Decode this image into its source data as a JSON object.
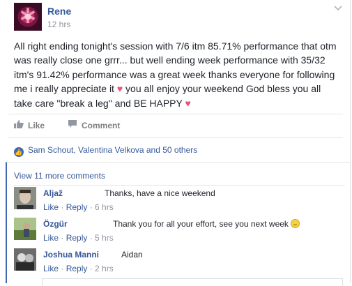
{
  "post": {
    "author": "Rene",
    "time": "12 hrs",
    "text": "All right ending tonight's session with 7/6 itm 85.71% performance that otm was really close one grrr... but well ending week performance with 35/32 itm's 91.42% performance was a great week thanks everyone for following me i really appreciate it",
    "text_mid": " you all enjoy your weekend God bless you all take care \"break a leg\" and BE HAPPY ",
    "heart_icon": "heart-icon"
  },
  "actions": {
    "like_label": "Like",
    "comment_label": "Comment"
  },
  "likes": {
    "text": "Sam Schout, Valentina Velkova and 50 others"
  },
  "comments_section": {
    "view_more": "View 11 more comments",
    "items": [
      {
        "name": "Aljaž",
        "text": "Thanks, have a nice weekend",
        "like": "Like",
        "reply": "Reply",
        "time": "6 hrs"
      },
      {
        "name": "Özgür",
        "text": "Thank you for all your effort, see you next week",
        "like": "Like",
        "reply": "Reply",
        "time": "5 hrs"
      },
      {
        "name": "Joshua Manni",
        "text": "Aidan",
        "like": "Like",
        "reply": "Reply",
        "time": "2 hrs"
      }
    ]
  },
  "colors": {
    "link": "#365899",
    "meta": "#90949c",
    "accent": "#4267b2",
    "heart": "#e8527b"
  }
}
